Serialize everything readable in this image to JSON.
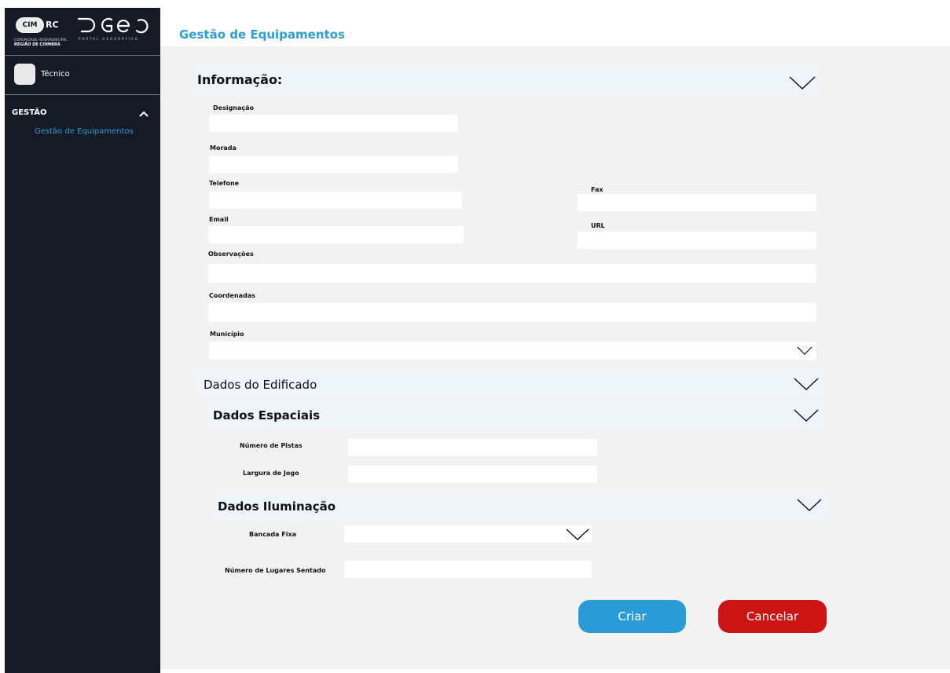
{
  "brand": {
    "cim_badge": "CIM",
    "cim_rc": "RC",
    "cim_line1": "COMUNIDADE INTERMUNICIPAL",
    "cim_line2": "REGIÃO DE COIMBRA",
    "pgeo_tagline": "PORTAL GEOGRÁFICO"
  },
  "sidebar": {
    "user_name": "Técnico",
    "section_label": "GESTÃO",
    "items": [
      {
        "label": "Gestão de Equipamentos",
        "active": true
      }
    ]
  },
  "page": {
    "title": "Gestão de Equipamentos"
  },
  "sections": {
    "informacao": "Informação:",
    "edificado": "Dados do Edificado",
    "espaciais": "Dados Espaciais",
    "iluminacao": "Dados Iluminação"
  },
  "fields": {
    "designacao": {
      "label": "Designação",
      "value": ""
    },
    "morada": {
      "label": "Morada",
      "value": ""
    },
    "telefone": {
      "label": "Telefone",
      "value": ""
    },
    "fax": {
      "label": "Fax",
      "value": ""
    },
    "email": {
      "label": "Email",
      "value": ""
    },
    "url": {
      "label": "URL",
      "value": ""
    },
    "observacoes": {
      "label": "Observações",
      "value": ""
    },
    "coordenadas": {
      "label": "Coordenadas",
      "value": ""
    },
    "municipio": {
      "label": "Município",
      "value": ""
    },
    "numero_pistas": {
      "label": "Número de Pistas",
      "value": ""
    },
    "largura_jogo": {
      "label": "Largura de Jogo",
      "value": ""
    },
    "bancada_fixa": {
      "label": "Bancada Fixa",
      "value": ""
    },
    "lugares_sentado": {
      "label": "Número de Lugares Sentado",
      "value": ""
    }
  },
  "actions": {
    "create_label": "Criar",
    "cancel_label": "Cancelar"
  },
  "colors": {
    "sidebar_bg": "#151a24",
    "accent": "#2a9fd6",
    "primary_button": "#2b9bd8",
    "danger_button": "#cc1414",
    "content_bg": "#f2f2f2",
    "section_bar": "#eef4fa"
  },
  "icons": {
    "section_toggle": "chevron-down-icon",
    "nav_toggle": "chevron-up-icon"
  }
}
